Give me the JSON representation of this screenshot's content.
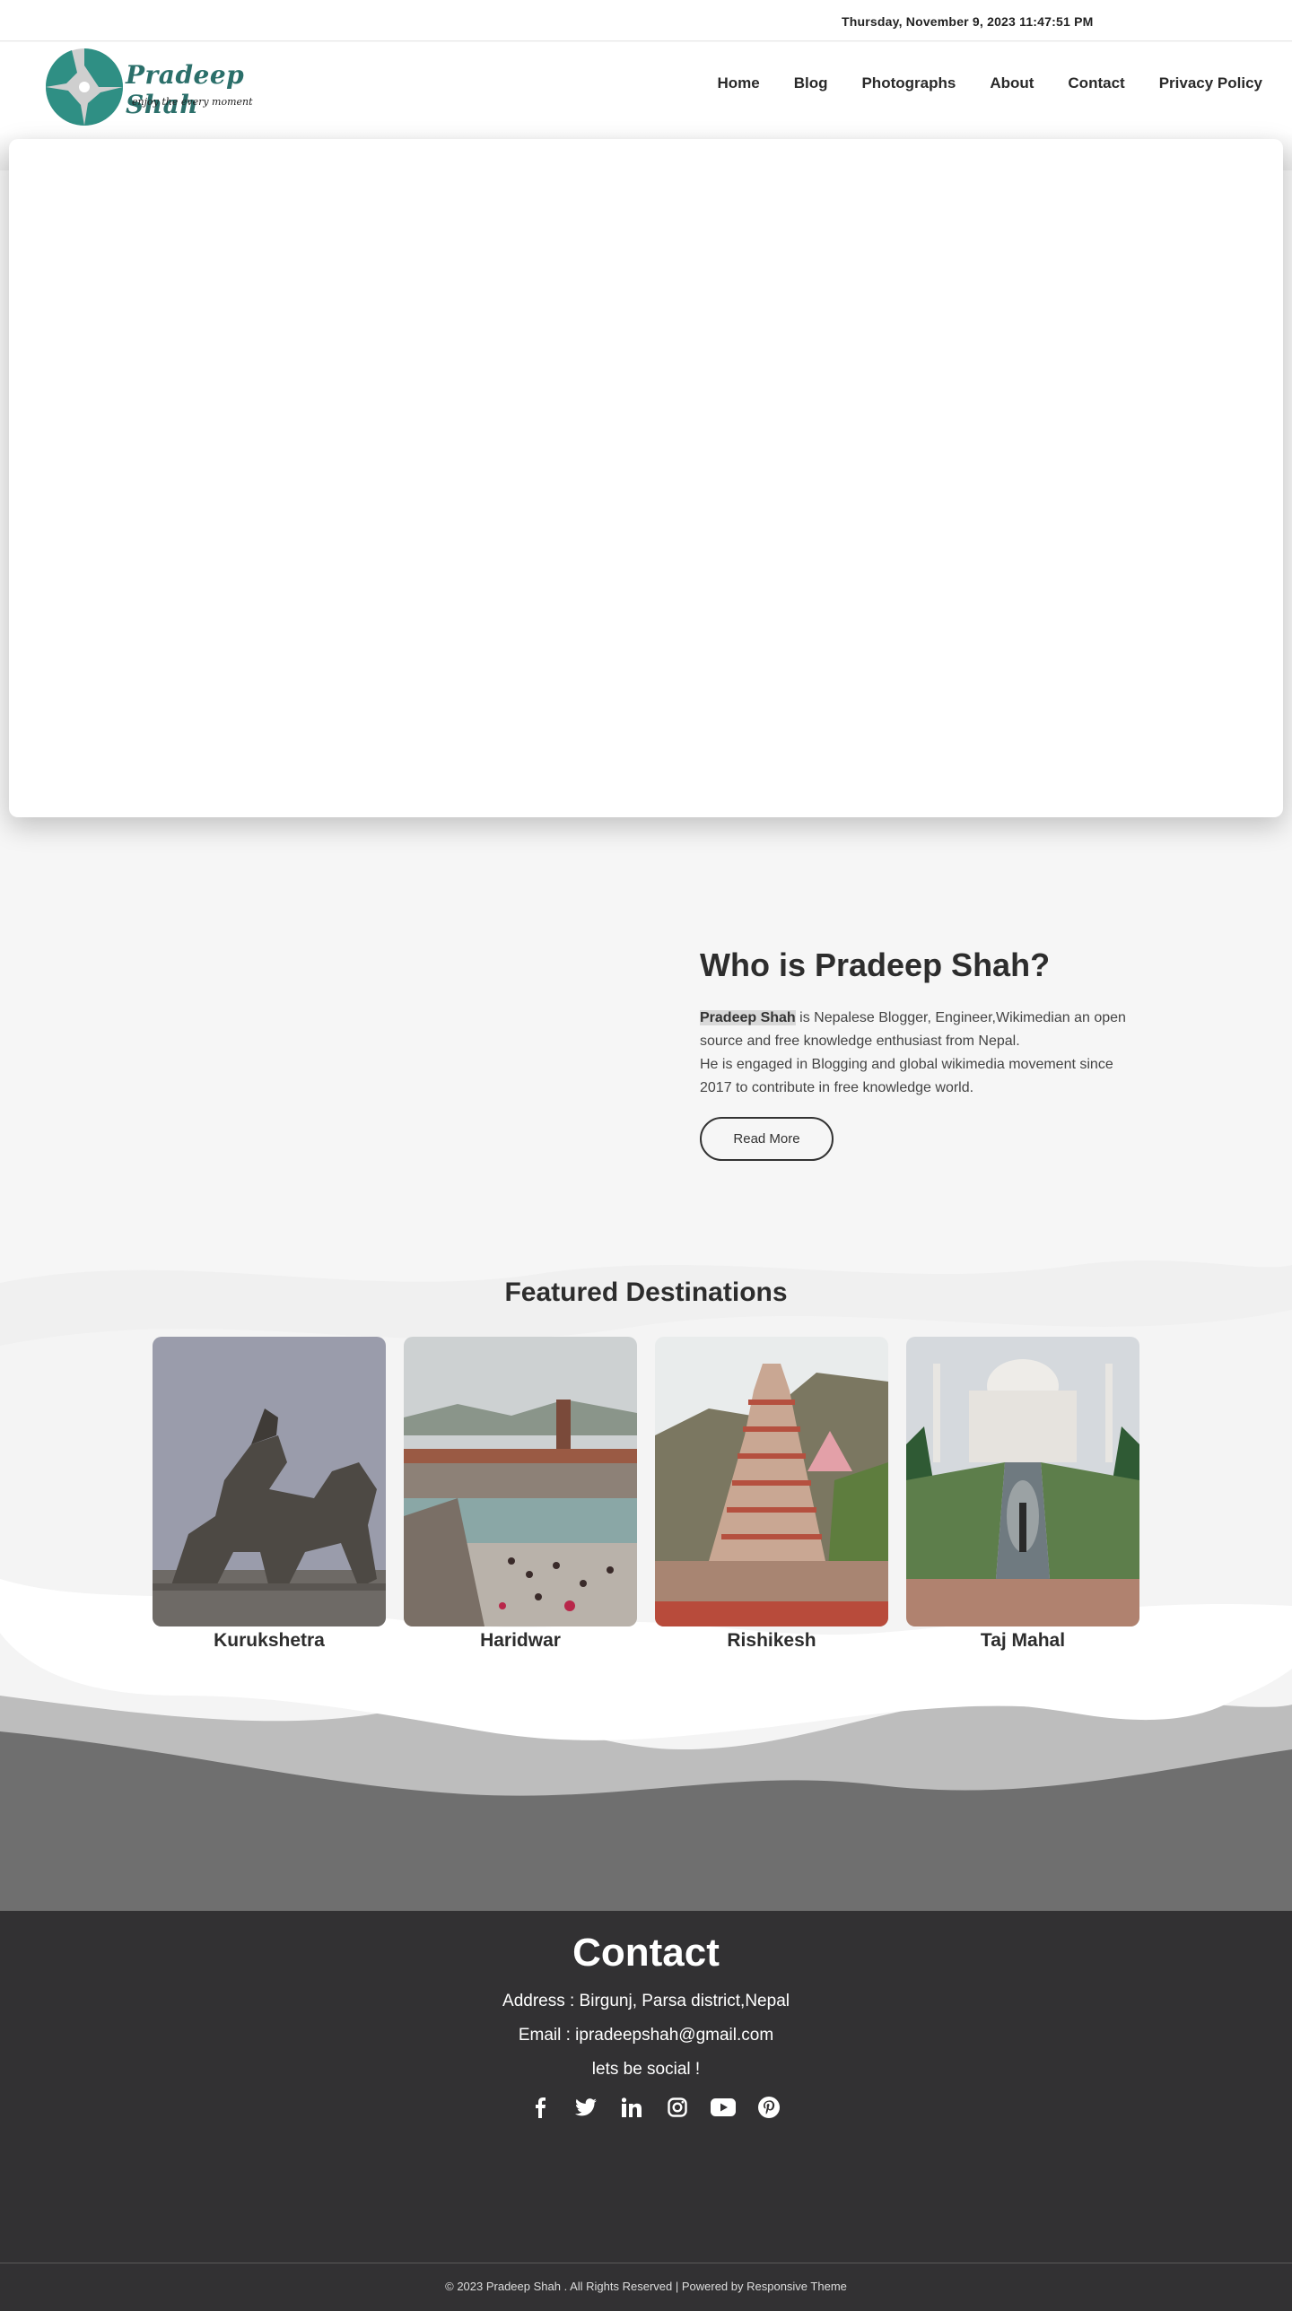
{
  "topbar": {
    "datetime": "Thursday, November 9, 2023 11:47:51 PM"
  },
  "header": {
    "logo_title": "Pradeep Shah",
    "logo_tagline": "enjoy the every moment",
    "nav": [
      "Home",
      "Blog",
      "Photographs",
      "About",
      "Contact",
      "Privacy Policy"
    ]
  },
  "about": {
    "title": "Who is Pradeep Shah?",
    "highlight": "Pradeep Shah",
    "text_1": " is Nepalese Blogger, Engineer,Wikimedian an open source and free knowledge enthusiast from Nepal.",
    "text_2": "He is engaged in Blogging and global wikimedia movement since 2017 to contribute in free knowledge world.",
    "button": "Read More"
  },
  "featured": {
    "title": "Featured Destinations",
    "destinations": [
      "Kurukshetra",
      "Haridwar",
      "Rishikesh",
      "Taj Mahal"
    ]
  },
  "contact": {
    "title": "Contact",
    "address": "Address : Birgunj, Parsa district,Nepal",
    "email": "Email : ipradeepshah@gmail.com",
    "social_label": "lets be social !",
    "social_icons": [
      "facebook-icon",
      "twitter-icon",
      "linkedin-icon",
      "instagram-icon",
      "youtube-icon",
      "pinterest-icon"
    ]
  },
  "footer": {
    "copyright": "© 2023 Pradeep Shah . All Rights Reserved | Powered by ",
    "theme_link": "Responsive Theme"
  },
  "colors": {
    "brand_teal": "#2f8f84",
    "footer_bg": "#323133",
    "text_dark": "#2d2d2d"
  }
}
